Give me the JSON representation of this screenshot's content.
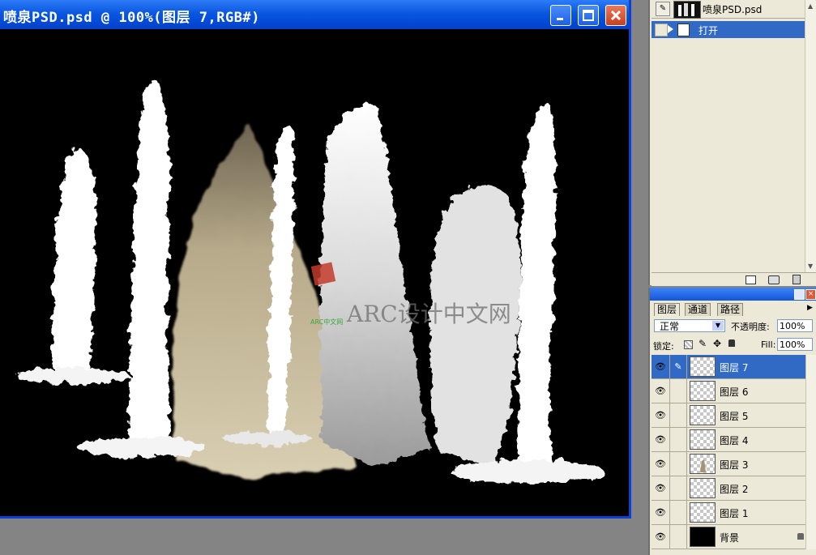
{
  "document": {
    "title": "喷泉PSD.psd @ 100%(图层 7,RGB#)"
  },
  "watermark": {
    "text": "ARC设计中文网",
    "sub": "ARC中文网"
  },
  "history": {
    "snapshot_name": "喷泉PSD.psd",
    "items": [
      {
        "label": "打开",
        "selected": true
      }
    ]
  },
  "layers": {
    "tabs": [
      {
        "label": "图层",
        "active": true
      },
      {
        "label": "通道",
        "active": false
      },
      {
        "label": "路径",
        "active": false
      }
    ],
    "blend_mode": "正常",
    "opacity_label": "不透明度:",
    "opacity_value": "100%",
    "lock_label": "锁定:",
    "fill_label": "Fill:",
    "fill_value": "100%",
    "items": [
      {
        "name": "图层 7",
        "selected": true,
        "visible": true,
        "thumb": "transparent"
      },
      {
        "name": "图层 6",
        "selected": false,
        "visible": true,
        "thumb": "transparent"
      },
      {
        "name": "图层 5",
        "selected": false,
        "visible": true,
        "thumb": "transparent"
      },
      {
        "name": "图层 4",
        "selected": false,
        "visible": true,
        "thumb": "transparent"
      },
      {
        "name": "图层 3",
        "selected": false,
        "visible": true,
        "thumb": "figure"
      },
      {
        "name": "图层 2",
        "selected": false,
        "visible": true,
        "thumb": "transparent"
      },
      {
        "name": "图层 1",
        "selected": false,
        "visible": true,
        "thumb": "transparent"
      },
      {
        "name": "背景",
        "selected": false,
        "visible": true,
        "thumb": "black",
        "locked": true
      }
    ]
  },
  "colors": {
    "titlebar": "#0a57e0",
    "selection": "#316ac5",
    "panel": "#ece9d8",
    "canvas": "#000000"
  }
}
